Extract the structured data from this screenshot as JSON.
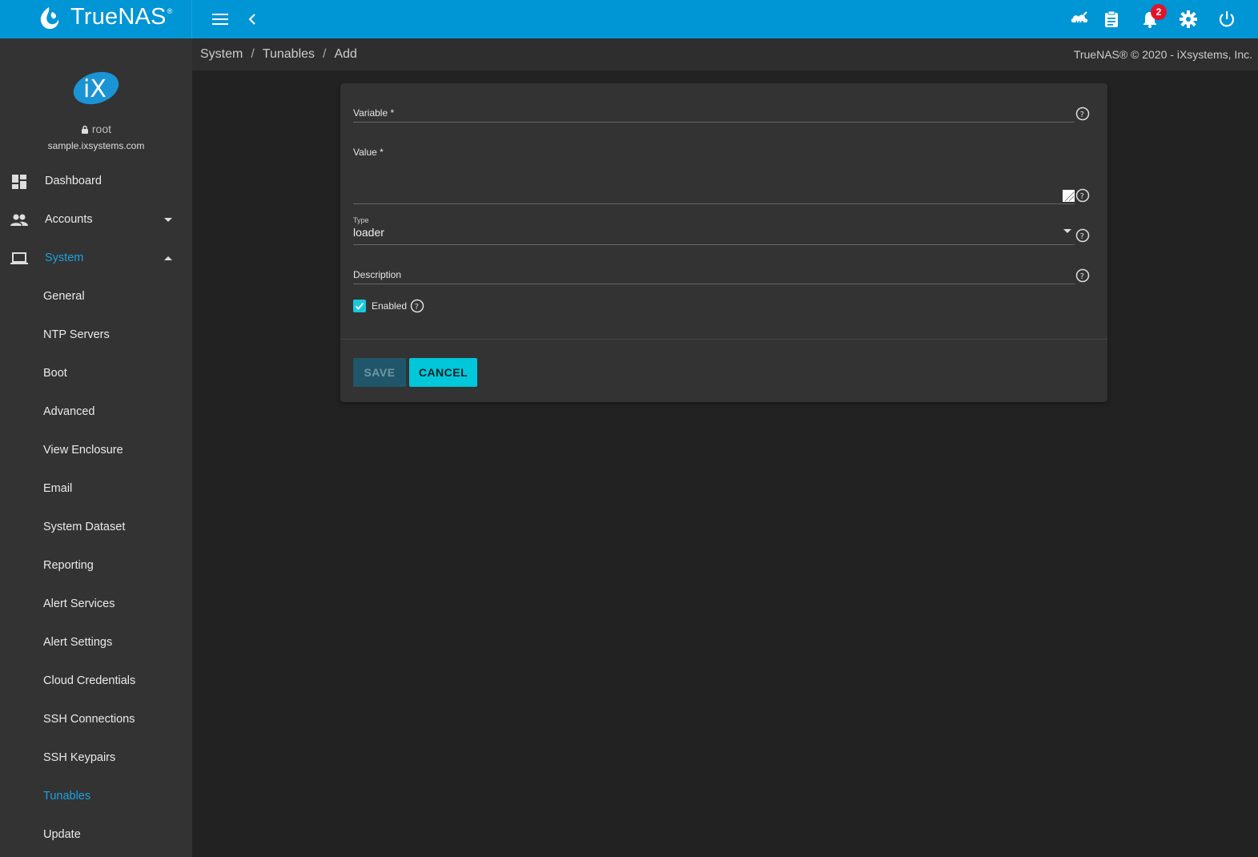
{
  "app": {
    "brand_name": "TrueNAS",
    "brand_mark": "®",
    "logo_icon": "truenas-logo-icon"
  },
  "topbar": {
    "menu_icon": "hamburger-menu-icon",
    "back_icon": "chevron-left-icon",
    "ha_icon": "ha-status-icon",
    "tasks_icon": "clipboard-icon",
    "notifications_icon": "bell-icon",
    "notification_count": "2",
    "settings_icon": "gear-icon",
    "power_icon": "power-icon",
    "accent_color": "#0095d5",
    "badge_color": "#e0152a"
  },
  "user": {
    "name": "root",
    "hostname": "sample.ixsystems.com"
  },
  "sidebar": {
    "nav": [
      {
        "label": "Dashboard",
        "icon": "dashboard-icon"
      },
      {
        "label": "Accounts",
        "icon": "people-icon",
        "expanded": false
      },
      {
        "label": "System",
        "icon": "laptop-icon",
        "expanded": true,
        "active": true
      }
    ],
    "system_items": [
      {
        "label": "General"
      },
      {
        "label": "NTP Servers"
      },
      {
        "label": "Boot"
      },
      {
        "label": "Advanced"
      },
      {
        "label": "View Enclosure"
      },
      {
        "label": "Email"
      },
      {
        "label": "System Dataset"
      },
      {
        "label": "Reporting"
      },
      {
        "label": "Alert Services"
      },
      {
        "label": "Alert Settings"
      },
      {
        "label": "Cloud Credentials"
      },
      {
        "label": "SSH Connections"
      },
      {
        "label": "SSH Keypairs"
      },
      {
        "label": "Tunables",
        "active": true
      },
      {
        "label": "Update"
      }
    ],
    "active_color": "#1ba2e0"
  },
  "breadcrumb": {
    "items": [
      "System",
      "Tunables",
      "Add"
    ],
    "separator": "/",
    "copyright": "TrueNAS® © 2020 - iXsystems, Inc."
  },
  "form": {
    "variable_label": "Variable *",
    "variable_value": "",
    "value_label": "Value *",
    "value_value": "",
    "type_label": "Type",
    "type_value": "loader",
    "description_label": "Description",
    "description_value": "",
    "enabled_label": "Enabled",
    "enabled_checked": true,
    "save_label": "SAVE",
    "cancel_label": "CANCEL",
    "save_disabled": true,
    "help_icon": "help-circle-icon",
    "checkbox_color": "#1ac8dc"
  }
}
